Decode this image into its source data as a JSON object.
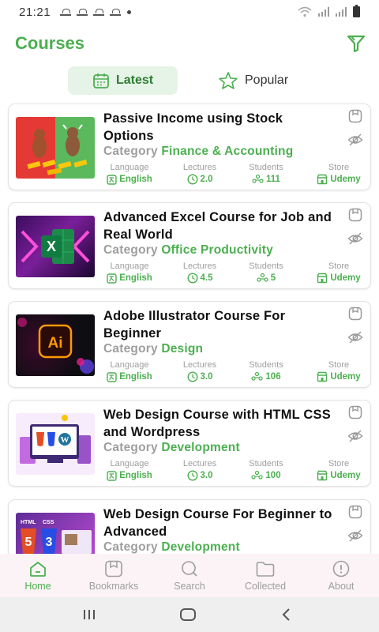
{
  "status_bar": {
    "time": "21:21"
  },
  "header": {
    "title": "Courses",
    "filter_icon": "filter-icon"
  },
  "tabs": [
    {
      "label": "Latest",
      "icon": "calendar-icon",
      "active": true
    },
    {
      "label": "Popular",
      "icon": "star-icon",
      "active": false
    }
  ],
  "meta_labels": {
    "language": "Language",
    "lectures": "Lectures",
    "students": "Students",
    "store": "Store"
  },
  "category_label": "Category",
  "courses": [
    {
      "title": "Passive Income using Stock Options",
      "category": "Finance & Accounting",
      "language": "English",
      "lectures": "2.0",
      "students": "111",
      "store": "Udemy"
    },
    {
      "title": "Advanced Excel Course for Job and Real World",
      "category": "Office Productivity",
      "language": "English",
      "lectures": "4.5",
      "students": "5",
      "store": "Udemy"
    },
    {
      "title": "Adobe Illustrator Course For Beginner",
      "category": "Design",
      "language": "English",
      "lectures": "3.0",
      "students": "106",
      "store": "Udemy"
    },
    {
      "title": "Web Design Course with HTML CSS and Wordpress",
      "category": "Development",
      "language": "English",
      "lectures": "3.0",
      "students": "100",
      "store": "Udemy"
    },
    {
      "title": "Web Design Course For Beginner to Advanced",
      "category": "Development"
    }
  ],
  "thumb_text": {
    "excel": "X",
    "illustrator": "Ai",
    "html": "HTML",
    "css": "CSS",
    "html_num": "5",
    "css_num": "3"
  },
  "bottom_nav": [
    {
      "label": "Home",
      "icon": "home-icon",
      "active": true
    },
    {
      "label": "Bookmarks",
      "icon": "bookmark-icon",
      "active": false
    },
    {
      "label": "Search",
      "icon": "search-icon",
      "active": false
    },
    {
      "label": "Collected",
      "icon": "folder-icon",
      "active": false
    },
    {
      "label": "About",
      "icon": "info-icon",
      "active": false
    }
  ],
  "colors": {
    "accent": "#4caf50",
    "muted": "#9e9e9e",
    "tab_active_bg": "#e6f3e7",
    "nav_bg": "#fbf3f5"
  }
}
